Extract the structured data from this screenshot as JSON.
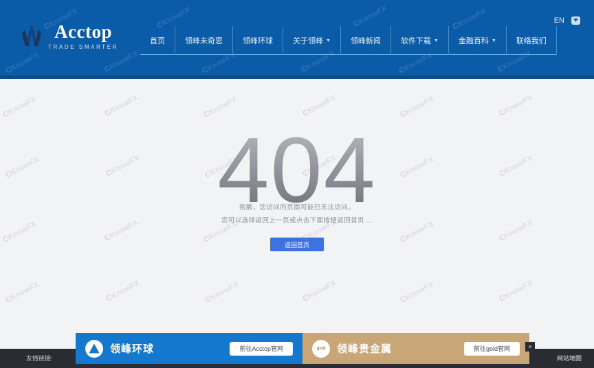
{
  "header": {
    "logo": {
      "name": "Acctop",
      "tagline": "TRADE SMARTER",
      "icon": "mountain-logo-icon"
    },
    "topright": {
      "lang": "EN",
      "wechat_icon": "wechat-icon"
    },
    "nav": [
      {
        "label": "首页",
        "caret": ""
      },
      {
        "label": "领峰未奇思",
        "caret": ""
      },
      {
        "label": "领峰环球",
        "caret": ""
      },
      {
        "label": "关于领峰",
        "caret": "▼"
      },
      {
        "label": "领峰新闻",
        "caret": ""
      },
      {
        "label": "软件下载",
        "caret": "▼"
      },
      {
        "label": "金融百科",
        "caret": "▼"
      },
      {
        "label": "联络我们",
        "caret": ""
      }
    ]
  },
  "main": {
    "error_code": "404",
    "message_line1": "抱歉，您访问的页面可能已无法访问。",
    "message_line2": "您可以选择返回上一页或点击下面按钮返回首页 ...",
    "home_button": "返回首页"
  },
  "promos": [
    {
      "title": "领峰环球",
      "button": "前往Acctop官网",
      "logo_icon": "acctop-circle-logo-icon",
      "color": "#1479ce"
    },
    {
      "title": "领峰贵金属",
      "button": "前往gold官网",
      "logo_icon": "gold-circle-logo-icon",
      "logo_text": "gold",
      "color": "#c8a678"
    }
  ],
  "promo_close": "×",
  "footer": {
    "friend_links_label": "友情链接:",
    "sitemap": "网站地图"
  },
  "watermark": {
    "text_a": "KnowFX",
    "text_c": "C"
  },
  "colors": {
    "header_blue": "#0a5ba8",
    "header_border": "#0d4d86",
    "page_bg": "#f2f3f4",
    "button_blue": "#3f72e0",
    "footer_dark": "#2b2b33",
    "gold": "#c8a678"
  }
}
